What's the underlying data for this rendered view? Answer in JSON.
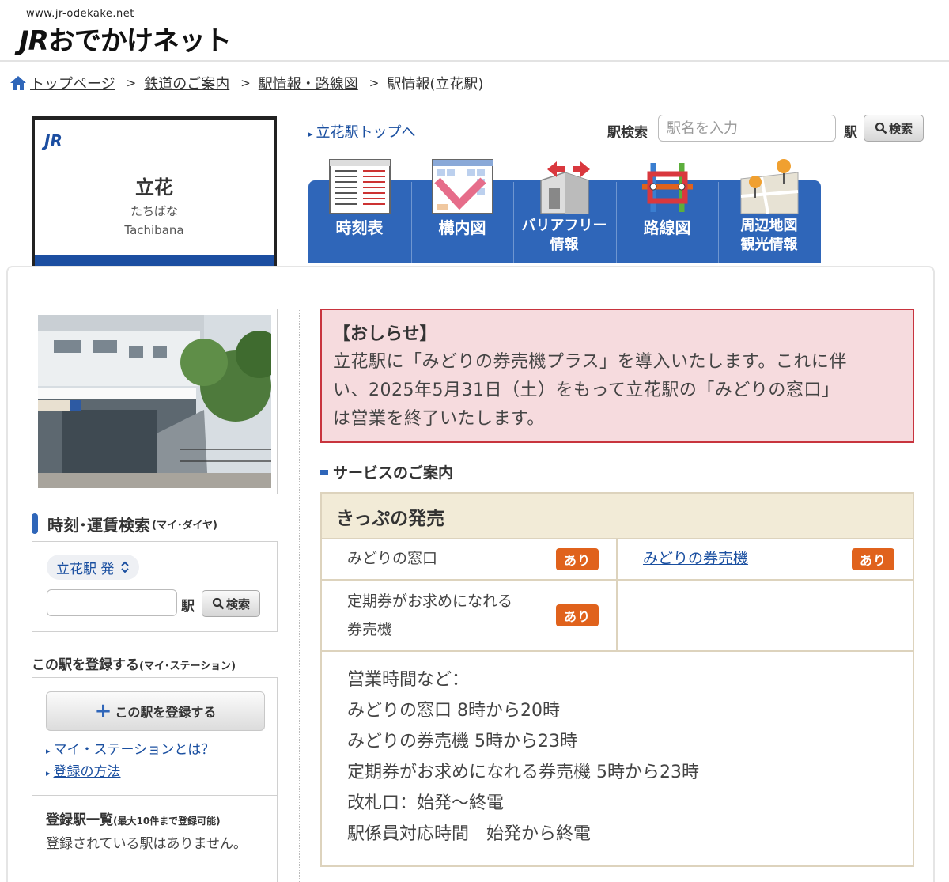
{
  "header": {
    "logo_url": "www.jr-odekake.net",
    "logo_jr": "JR",
    "logo_text": "おでかけネット"
  },
  "breadcrumb": {
    "items": [
      "トップページ",
      "鉄道のご案内",
      "駅情報・路線図",
      "駅情報(立花駅)"
    ],
    "separator": ">"
  },
  "station": {
    "logo": "JR",
    "name": "立花",
    "kana": "たちばな",
    "roman": "Tachibana",
    "top_link": "立花駅トップへ"
  },
  "search": {
    "label": "駅検索",
    "placeholder": "駅名を入力",
    "suffix": "駅",
    "button": "検索"
  },
  "tabs": [
    {
      "label": "時刻表",
      "icon": "timetable-icon"
    },
    {
      "label": "構内図",
      "icon": "station-map-icon"
    },
    {
      "label_1": "バリアフリー",
      "label_2": "情報",
      "icon": "barrier-free-icon"
    },
    {
      "label": "路線図",
      "icon": "route-map-icon"
    },
    {
      "label_1": "周辺地図",
      "label_2": "観光情報",
      "icon": "area-map-icon"
    }
  ],
  "sidebar": {
    "fare_heading": "時刻･運賃検索",
    "fare_heading_sub": "(マイ･ダイヤ)",
    "departure": "立花駅 発",
    "suffix": "駅",
    "button": "検索",
    "register_heading": "この駅を登録する",
    "register_heading_sub": "(マイ･ステーション)",
    "register_button": "この駅を登録する",
    "links": [
      "マイ・ステーションとは？",
      "登録の方法"
    ],
    "list_title": "登録駅一覧",
    "list_title_sub": "(最大10件まで登録可能)",
    "list_empty": "登録されている駅はありません。"
  },
  "notice": {
    "title": "【おしらせ】",
    "line_1": "立花駅に「みどりの券売機プラス」を導入いたします。これに伴",
    "line_2": "い、2025年5月31日（土）をもって立花駅の「みどりの窓口」",
    "line_3": "は営業を終了いたします。"
  },
  "services": {
    "heading": "サービスのご案内",
    "ticket_heading": "きっぷの発売",
    "midori_window": "みどりの窓口",
    "midori_machine": "みどりの券売機",
    "teiki_machine_1": "定期券がお求めになれる",
    "teiki_machine_2": "券売機",
    "available": "あり",
    "hours": [
      "営業時間など：",
      "みどりの窓口 8時から20時",
      "みどりの券売機 5時から23時",
      "定期券がお求めになれる券売機 5時から23時",
      "改札口：始発～終電",
      "駅係員対応時間　始発から終電"
    ]
  },
  "colors": {
    "brand_blue": "#2f66b9",
    "badge_orange": "#e0621c",
    "notice_border": "#c8343e",
    "notice_bg": "#f6dbde"
  }
}
